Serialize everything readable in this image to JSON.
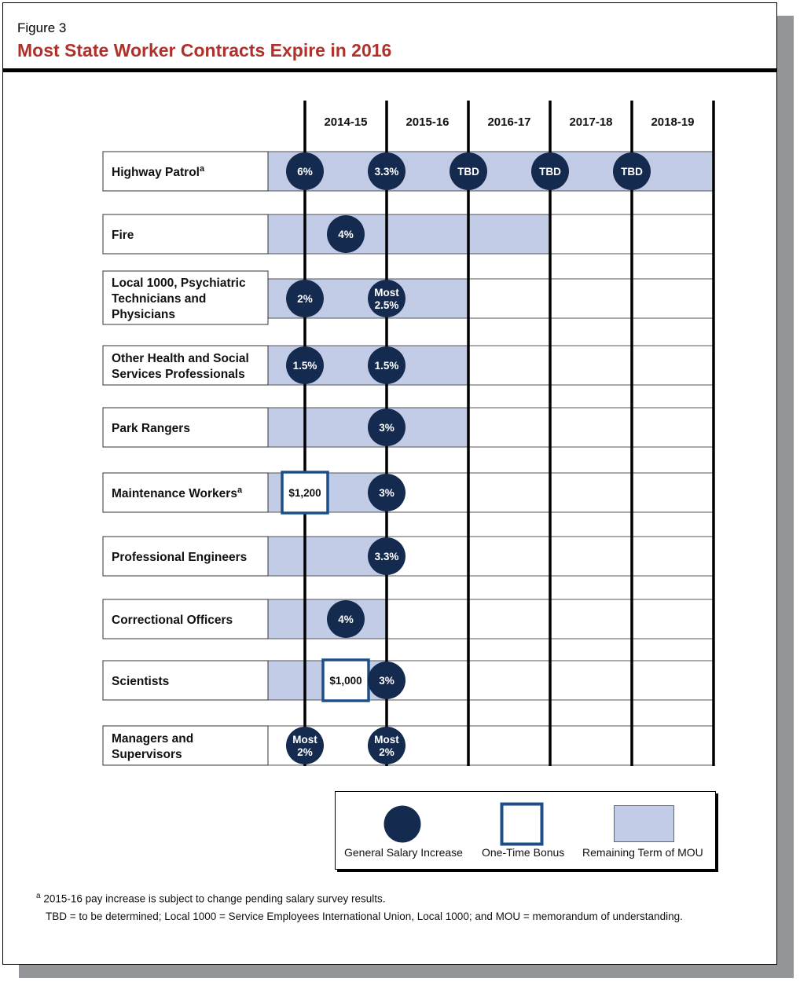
{
  "figure": {
    "number": "Figure 3",
    "title": "Most State Worker Contracts Expire in 2016"
  },
  "colors": {
    "title": "#b0312a",
    "salary_circle": "#142a4e",
    "bonus_border": "#1c4f8a",
    "mou_fill": "#c3cce7",
    "shadow": "#939598"
  },
  "chart_data": {
    "type": "table",
    "title": "Most State Worker Contracts Expire in 2016",
    "columns": [
      "2014-15",
      "2015-16",
      "2016-17",
      "2017-18",
      "2018-19"
    ],
    "boundaries_note": "Vertical lines mark fiscal-year boundaries: 2014-15 start, 2015-16 start, 2016-17 start, 2017-18 start, 2018-19 start, 2018-19 end",
    "rows": [
      {
        "label": "Highway Patrol",
        "footnote": "a",
        "mou_remaining": {
          "from_year": 2014.0,
          "to_year": 2019.0
        },
        "events": [
          {
            "type": "salary",
            "position": 2014.0,
            "text": "6%"
          },
          {
            "type": "salary",
            "position": 2015.0,
            "text": "3.3%"
          },
          {
            "type": "salary",
            "position": 2016.0,
            "text": "TBD"
          },
          {
            "type": "salary",
            "position": 2017.0,
            "text": "TBD"
          },
          {
            "type": "salary",
            "position": 2018.0,
            "text": "TBD"
          }
        ]
      },
      {
        "label": "Fire",
        "footnote": "",
        "mou_remaining": {
          "from_year": 2014.0,
          "to_year": 2017.0
        },
        "events": [
          {
            "type": "salary",
            "position": 2014.5,
            "text": "4%"
          }
        ]
      },
      {
        "label": "Local 1000, Psychiatric Technicians and Physicians",
        "footnote": "",
        "mou_remaining": {
          "from_year": 2014.0,
          "to_year": 2016.0
        },
        "events": [
          {
            "type": "salary",
            "position": 2014.0,
            "text": "2%"
          },
          {
            "type": "salary",
            "position": 2015.0,
            "text": "Most 2.5%"
          }
        ]
      },
      {
        "label": "Other Health and Social Services Professionals",
        "footnote": "",
        "mou_remaining": {
          "from_year": 2014.0,
          "to_year": 2016.0
        },
        "events": [
          {
            "type": "salary",
            "position": 2014.0,
            "text": "1.5%"
          },
          {
            "type": "salary",
            "position": 2015.0,
            "text": "1.5%"
          }
        ]
      },
      {
        "label": "Park Rangers",
        "footnote": "",
        "mou_remaining": {
          "from_year": 2014.0,
          "to_year": 2016.0
        },
        "events": [
          {
            "type": "salary",
            "position": 2015.0,
            "text": "3%"
          }
        ]
      },
      {
        "label": "Maintenance Workers",
        "footnote": "a",
        "mou_remaining": {
          "from_year": 2014.0,
          "to_year": 2015.0
        },
        "events": [
          {
            "type": "bonus",
            "position": 2014.0,
            "text": "$1,200"
          },
          {
            "type": "salary",
            "position": 2015.0,
            "text": "3%"
          }
        ]
      },
      {
        "label": "Professional Engineers",
        "footnote": "",
        "mou_remaining": {
          "from_year": 2014.0,
          "to_year": 2015.0
        },
        "events": [
          {
            "type": "salary",
            "position": 2015.0,
            "text": "3.3%"
          }
        ]
      },
      {
        "label": "Correctional Officers",
        "footnote": "",
        "mou_remaining": {
          "from_year": 2014.0,
          "to_year": 2015.0
        },
        "events": [
          {
            "type": "salary",
            "position": 2014.5,
            "text": "4%"
          }
        ]
      },
      {
        "label": "Scientists",
        "footnote": "",
        "mou_remaining": {
          "from_year": 2014.0,
          "to_year": 2015.0
        },
        "events": [
          {
            "type": "bonus",
            "position": 2014.5,
            "text": "$1,000"
          },
          {
            "type": "salary",
            "position": 2015.0,
            "text": "3%"
          }
        ]
      },
      {
        "label": "Managers and Supervisors",
        "footnote": "",
        "mou_remaining": null,
        "events": [
          {
            "type": "salary",
            "position": 2014.0,
            "text": "Most 2%"
          },
          {
            "type": "salary",
            "position": 2015.0,
            "text": "Most 2%"
          }
        ]
      }
    ],
    "legend": [
      "General Salary Increase",
      "One-Time Bonus",
      "Remaining Term of MOU"
    ],
    "legend_placement": "bottom-right"
  },
  "legend": {
    "salary": "General Salary Increase",
    "bonus": "One-Time Bonus",
    "mou": "Remaining Term of MOU"
  },
  "footnotes": {
    "a_marker": "a",
    "a_text": " 2015-16 pay increase is subject to change pending salary survey results.",
    "abbrev": "TBD = to be determined; Local 1000 = Service Employees International Union, Local 1000; and MOU = memorandum of understanding."
  }
}
